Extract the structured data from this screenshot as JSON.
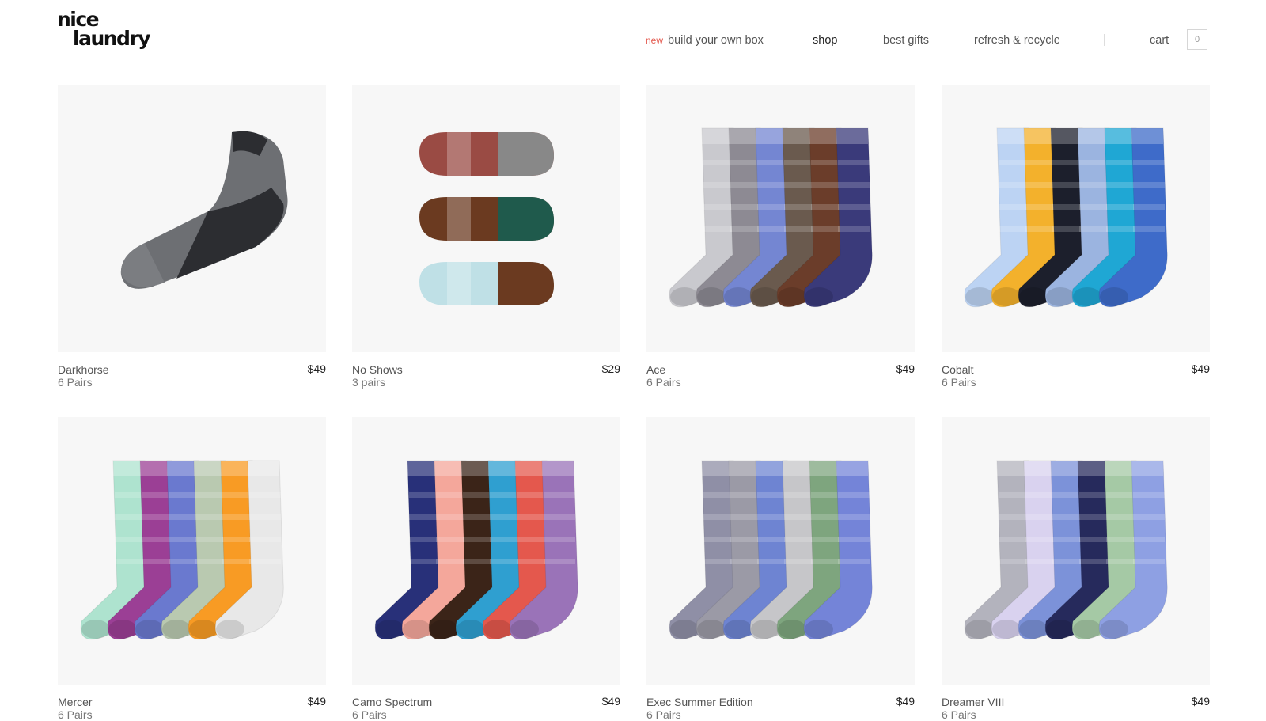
{
  "brand": {
    "logo_line1": "nice",
    "logo_line2": "laundry"
  },
  "nav": {
    "new_badge": "new",
    "build_box": "build your own box",
    "shop": "shop",
    "best_gifts": "best gifts",
    "refresh_recycle": "refresh & recycle",
    "cart": "cart",
    "cart_count": "0"
  },
  "products": [
    {
      "name": "Darkhorse",
      "pairs": "6 Pairs",
      "price": "$49",
      "colors": [
        "#6d6f73",
        "#2c2d31",
        "#5a5c61",
        "#7b7d81"
      ]
    },
    {
      "name": "No Shows",
      "pairs": "3 pairs",
      "price": "$29",
      "colors": [
        "#9a4b44",
        "#1f5a4c",
        "#6b3a20",
        "#bfe0e6"
      ]
    },
    {
      "name": "Ace",
      "pairs": "6 Pairs",
      "price": "$49",
      "colors": [
        "#c9c9ce",
        "#8d8a93",
        "#7486d2",
        "#6a5a4e",
        "#6b3d2a",
        "#3a3a7a"
      ]
    },
    {
      "name": "Cobalt",
      "pairs": "6 Pairs",
      "price": "$49",
      "colors": [
        "#bcd3f3",
        "#f3b12c",
        "#1c1f2c",
        "#9bb4e0",
        "#1fa7d4",
        "#3e6bc9"
      ]
    },
    {
      "name": "Mercer",
      "pairs": "6 Pairs",
      "price": "$49",
      "colors": [
        "#aee3cf",
        "#9b3f95",
        "#6a79cf",
        "#b9c9b0",
        "#f89b24",
        "#e8e8e8"
      ]
    },
    {
      "name": "Camo Spectrum",
      "pairs": "6 Pairs",
      "price": "$49",
      "colors": [
        "#283079",
        "#f4a79b",
        "#3b2418",
        "#2f9fd0",
        "#e4584d",
        "#9a73b8"
      ]
    },
    {
      "name": "Exec Summer Edition",
      "pairs": "6 Pairs",
      "price": "$49",
      "colors": [
        "#8f8fa6",
        "#9b9aa6",
        "#6e84d2",
        "#c6c6c9",
        "#7ea57e",
        "#7484d8"
      ]
    },
    {
      "name": "Dreamer VIII",
      "pairs": "6 Pairs",
      "price": "$49",
      "colors": [
        "#b3b3bd",
        "#d9d2ef",
        "#7c92d9",
        "#262a5c",
        "#a5c9a5",
        "#8ea0e3"
      ]
    }
  ]
}
